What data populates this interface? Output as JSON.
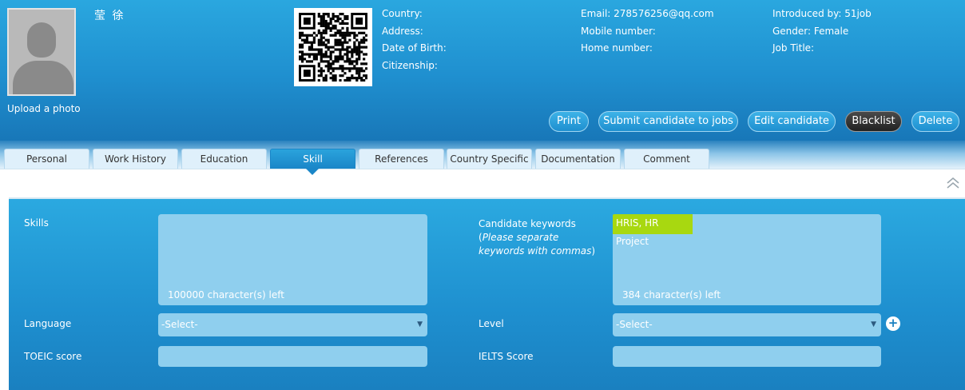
{
  "profile": {
    "name": "莹 徐",
    "upload_label": "Upload a photo"
  },
  "info_col1": [
    "Country:",
    "Address:",
    "Date of Birth:",
    "Citizenship:"
  ],
  "info_col2": [
    "Email: 278576256@qq.com",
    "Mobile number:",
    "Home number:"
  ],
  "info_col3": [
    "Introduced by: 51job",
    "Gender: Female",
    "Job Title:"
  ],
  "actions": {
    "print": "Print",
    "submit": "Submit candidate to jobs",
    "edit": "Edit candidate",
    "blacklist": "Blacklist",
    "delete": "Delete"
  },
  "tabs": [
    "Personal",
    "Work History",
    "Education",
    "Skill",
    "References",
    "Country Specific",
    "Documentation",
    "Comment"
  ],
  "active_tab": "Skill",
  "form": {
    "skills_label": "Skills",
    "skills_counter": "100000 character(s) left",
    "keywords_label": "Candidate keywords",
    "keywords_hint_open": "(",
    "keywords_hint": "Please separate keywords with commas",
    "keywords_hint_close": ")",
    "keywords_value": "HRIS, HR Project",
    "keywords_counter": "384 character(s) left",
    "language_label": "Language",
    "language_value": "-Select-",
    "level_label": "Level",
    "level_value": "-Select-",
    "toeic_label": "TOEIC score",
    "ielts_label": "IELTS Score"
  },
  "icons": {
    "collapse": "double-chevron-up-icon",
    "add": "plus-circle-icon",
    "avatar": "person-silhouette-icon",
    "qr": "qr-code-icon"
  }
}
